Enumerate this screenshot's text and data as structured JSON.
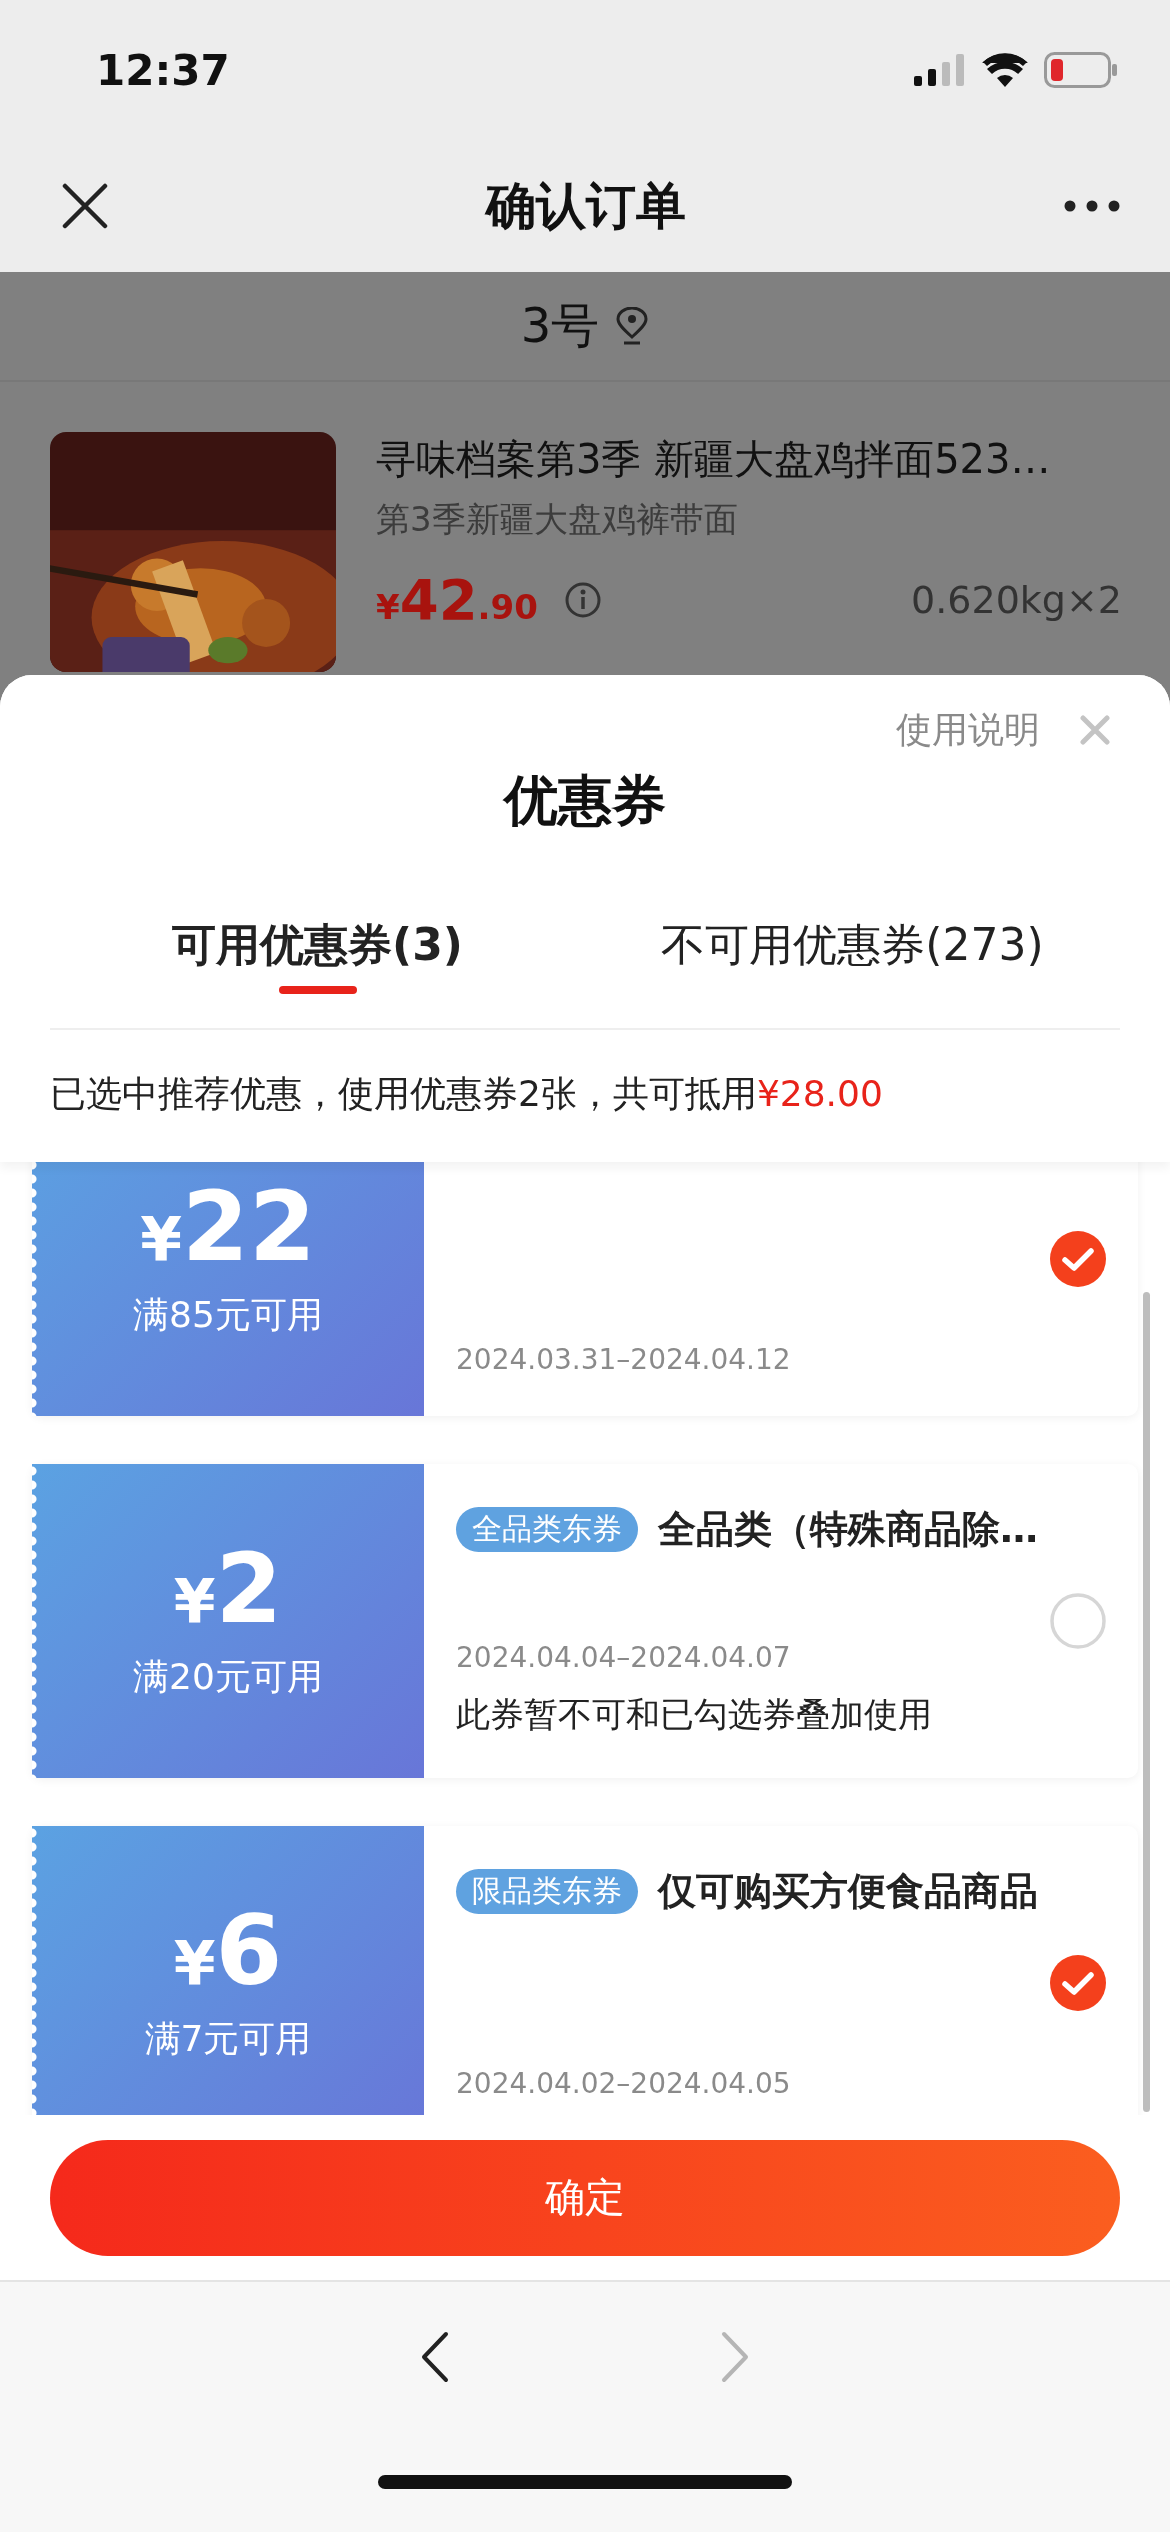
{
  "status_bar": {
    "time": "12:37"
  },
  "nav": {
    "title": "确认订单"
  },
  "store": {
    "name": "3号"
  },
  "product": {
    "title": "寻味档案第3季 新疆大盘鸡拌面523…",
    "subtitle": "第3季新疆大盘鸡裤带面",
    "price_symbol": "¥",
    "price_int": "42",
    "price_dec": ".90",
    "quantity": "0.620kg×2"
  },
  "coupon_sheet": {
    "title": "优惠券",
    "help_link": "使用说明",
    "tabs": [
      {
        "label": "可用优惠券(3)",
        "selected": true
      },
      {
        "label": "不可用优惠券(273)",
        "selected": false
      }
    ],
    "summary": "已选中推荐优惠，使用优惠券2张，共可抵用",
    "summary_amount": "¥28.00",
    "coupons": [
      {
        "symbol": "¥",
        "amount": "22",
        "condition": "满85元可用",
        "date_range": "2024.03.31–2024.04.12",
        "selected": true
      },
      {
        "symbol": "¥",
        "amount": "2",
        "condition": "满20元可用",
        "tag": "全品类东券",
        "name": "全品类（特殊商品除…",
        "date_range": "2024.04.04–2024.04.07",
        "note": "此券暂不可和已勾选券叠加使用",
        "selected": false
      },
      {
        "symbol": "¥",
        "amount": "6",
        "condition": "满7元可用",
        "tag": "限品类东券",
        "name": "仅可购买方便食品商品",
        "date_range": "2024.04.02–2024.04.05",
        "selected": true
      }
    ],
    "confirm": "确定"
  },
  "toolbar": {
    "back": {
      "disabled": false
    },
    "forward": {
      "disabled": true
    }
  }
}
